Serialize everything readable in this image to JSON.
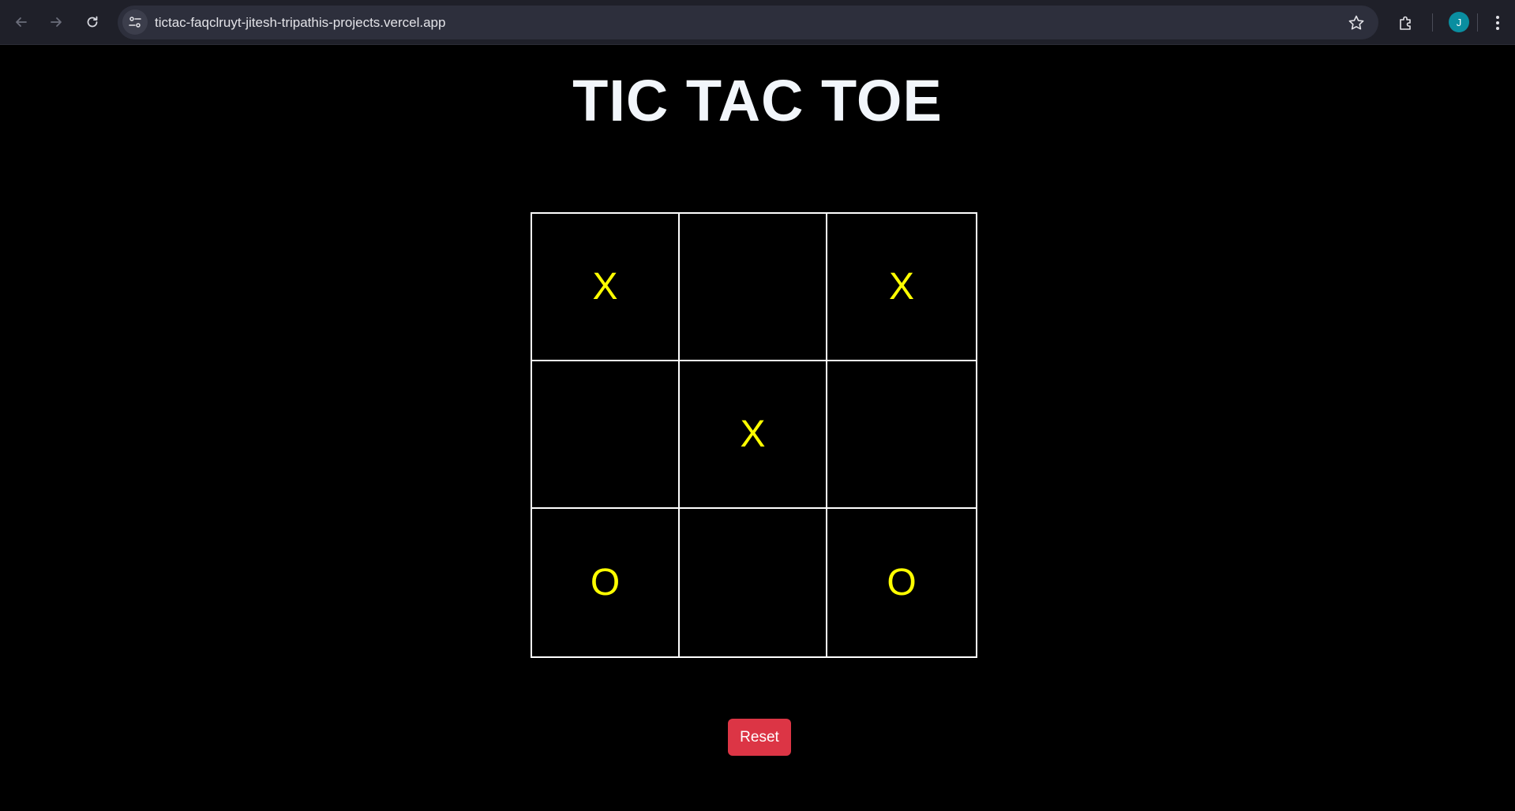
{
  "browser": {
    "url": "tictac-faqclruyt-jitesh-tripathis-projects.vercel.app",
    "profile_initial": "J",
    "icons": {
      "back": "arrow-left-icon",
      "forward": "arrow-right-icon",
      "reload": "reload-icon",
      "site_info": "tune-icon",
      "bookmark": "star-icon",
      "extensions": "puzzle-icon",
      "menu": "kebab-menu-icon"
    }
  },
  "game": {
    "title": "TIC TAC TOE",
    "board": [
      [
        "X",
        "",
        "X"
      ],
      [
        "",
        "X",
        ""
      ],
      [
        "O",
        "",
        "O"
      ]
    ],
    "reset_label": "Reset"
  },
  "colors": {
    "page_background": "#000000",
    "title": "#f2f6fb",
    "marks": "#ffff00",
    "grid_lines": "#ffffff",
    "reset_button": "#dc3545",
    "browser_toolbar": "#1f2029",
    "omnibox": "#2d2f3c",
    "avatar": "#0a8ea0"
  }
}
